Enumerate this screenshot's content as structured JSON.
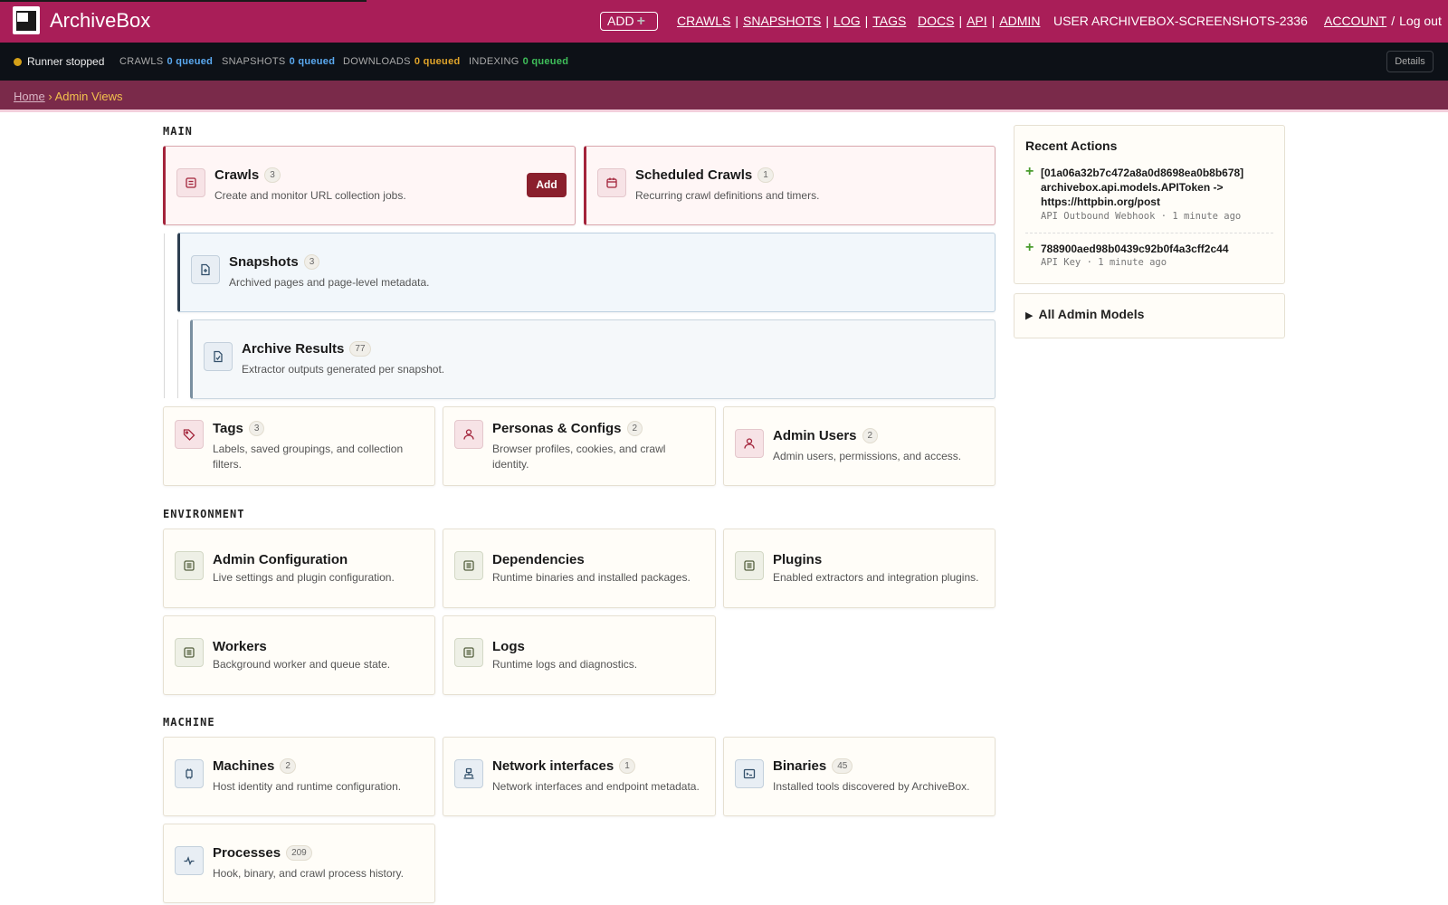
{
  "header": {
    "brand": "ArchiveBox",
    "add_label": "ADD",
    "nav": {
      "crawls": "CRAWLS",
      "snapshots": "SNAPSHOTS",
      "log": "LOG",
      "tags": "TAGS",
      "docs": "DOCS",
      "api": "API",
      "admin": "ADMIN",
      "user": "USER ARCHIVEBOX-SCREENSHOTS-2336",
      "account": "ACCOUNT",
      "logout": "Log out"
    }
  },
  "status": {
    "runner": "Runner stopped",
    "items": [
      {
        "label": "CRAWLS",
        "value": "0 queued",
        "color": "#5aa9f0"
      },
      {
        "label": "SNAPSHOTS",
        "value": "0 queued",
        "color": "#5aa9f0"
      },
      {
        "label": "DOWNLOADS",
        "value": "0 queued",
        "color": "#e0a42a"
      },
      {
        "label": "INDEXING",
        "value": "0 queued",
        "color": "#3fbf5a"
      }
    ],
    "details_label": "Details"
  },
  "breadcrumb": {
    "home": "Home",
    "sep": "›",
    "current": "Admin Views"
  },
  "sections": {
    "main": "MAIN",
    "environment": "ENVIRONMENT",
    "machine": "MACHINE"
  },
  "cards": {
    "crawls": {
      "title": "Crawls",
      "count": "3",
      "desc": "Create and monitor URL collection jobs.",
      "action": "Add"
    },
    "scheduled": {
      "title": "Scheduled Crawls",
      "count": "1",
      "desc": "Recurring crawl definitions and timers."
    },
    "snapshots": {
      "title": "Snapshots",
      "count": "3",
      "desc": "Archived pages and page-level metadata."
    },
    "archive_results": {
      "title": "Archive Results",
      "count": "77",
      "desc": "Extractor outputs generated per snapshot."
    },
    "tags": {
      "title": "Tags",
      "count": "3",
      "desc": "Labels, saved groupings, and collection filters."
    },
    "personas": {
      "title": "Personas & Configs",
      "count": "2",
      "desc": "Browser profiles, cookies, and crawl identity."
    },
    "admin_users": {
      "title": "Admin Users",
      "count": "2",
      "desc": "Admin users, permissions, and access."
    },
    "admin_config": {
      "title": "Admin Configuration",
      "desc": "Live settings and plugin configuration."
    },
    "dependencies": {
      "title": "Dependencies",
      "desc": "Runtime binaries and installed packages."
    },
    "plugins": {
      "title": "Plugins",
      "desc": "Enabled extractors and integration plugins."
    },
    "workers": {
      "title": "Workers",
      "desc": "Background worker and queue state."
    },
    "logs": {
      "title": "Logs",
      "desc": "Runtime logs and diagnostics."
    },
    "machines": {
      "title": "Machines",
      "count": "2",
      "desc": "Host identity and runtime configuration."
    },
    "network": {
      "title": "Network interfaces",
      "count": "1",
      "desc": "Network interfaces and endpoint metadata."
    },
    "binaries": {
      "title": "Binaries",
      "count": "45",
      "desc": "Installed tools discovered by ArchiveBox."
    },
    "processes": {
      "title": "Processes",
      "count": "209",
      "desc": "Hook, binary, and crawl process history."
    }
  },
  "sidebar": {
    "recent_title": "Recent Actions",
    "actions": [
      {
        "text": "[01a06a32b7c472a8a0d8698ea0b8b678] archivebox.api.models.APIToken -> https://httpbin.org/post",
        "meta": "API Outbound Webhook · 1 minute ago"
      },
      {
        "text": "788900aed98b0439c92b0f4a3cff2c44",
        "meta": "API Key · 1 minute ago"
      }
    ],
    "all_models": "All Admin Models"
  },
  "colors": {
    "brand": "#a91e58",
    "status_bg": "#0d1117",
    "breadcrumb_bg": "#7a2a4a",
    "accent_red": "#a3243b",
    "crumb_current": "#f2c14e"
  }
}
